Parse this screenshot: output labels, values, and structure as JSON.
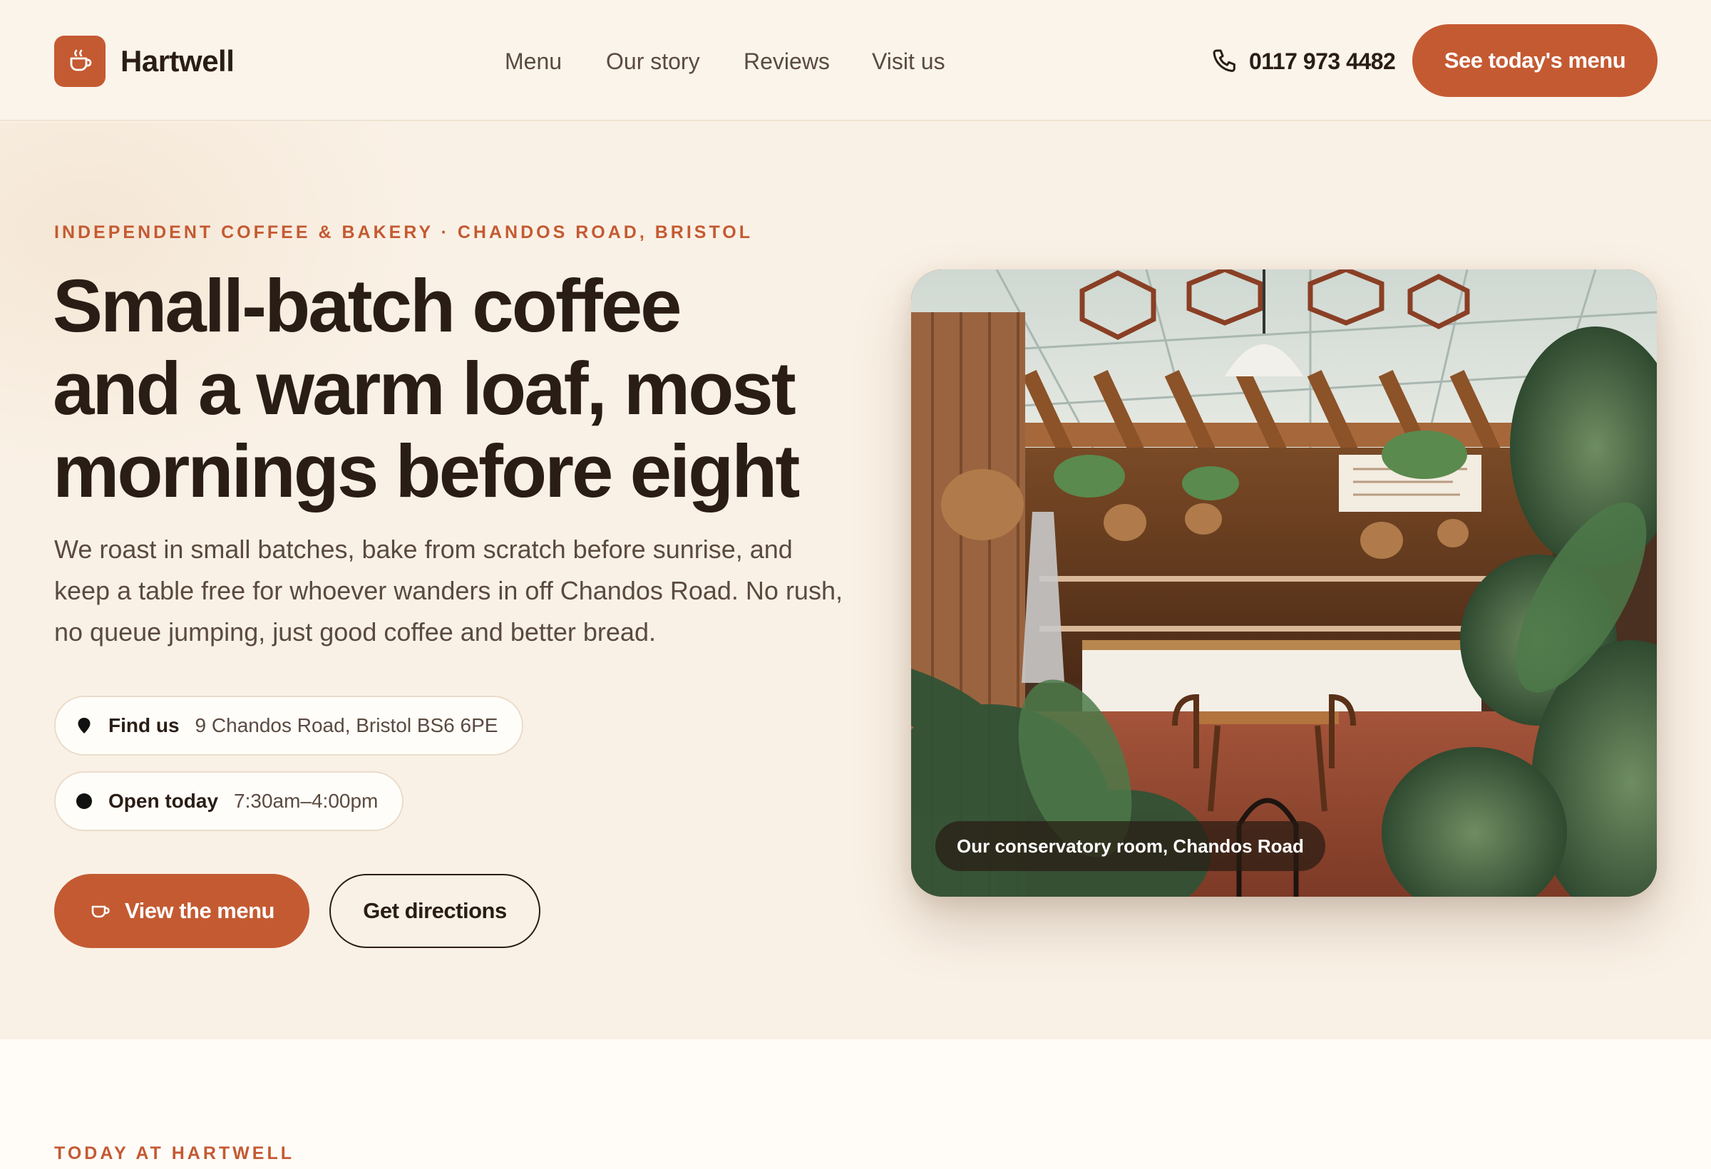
{
  "header": {
    "brand": "Hartwell",
    "nav": [
      {
        "label": "Menu"
      },
      {
        "label": "Our story"
      },
      {
        "label": "Reviews"
      },
      {
        "label": "Visit us"
      }
    ],
    "phone": "0117 973 4482",
    "cta_label": "See today's menu"
  },
  "hero": {
    "eyebrow": "INDEPENDENT COFFEE & BAKERY · CHANDOS ROAD, BRISTOL",
    "title_lines": [
      "Small-batch coffee",
      "and a warm loaf, most",
      "mornings before eight"
    ],
    "description": "We roast in small batches, bake from scratch before sunrise, and keep a table free for whoever wanders in off Chandos Road. No rush, no queue jumping, just good coffee and better bread.",
    "find_us": {
      "label": "Find us",
      "value": "9 Chandos Road, Bristol BS6 6PE"
    },
    "open_today": {
      "label": "Open today",
      "value": "7:30am–4:00pm"
    },
    "primary_button": "View the menu",
    "secondary_button": "Get directions",
    "photo_caption": "Our conservatory room, Chandos Road"
  },
  "section": {
    "eyebrow": "TODAY AT HARTWELL"
  },
  "colors": {
    "accent": "#c45a32",
    "background": "#faf1e6",
    "ink": "#2a1d15"
  },
  "icons": {
    "logo": "coffee-cup-icon",
    "phone": "phone-icon",
    "find_us": "map-pin-icon",
    "open_today": "status-dot-icon",
    "primary_button": "coffee-cup-icon"
  }
}
